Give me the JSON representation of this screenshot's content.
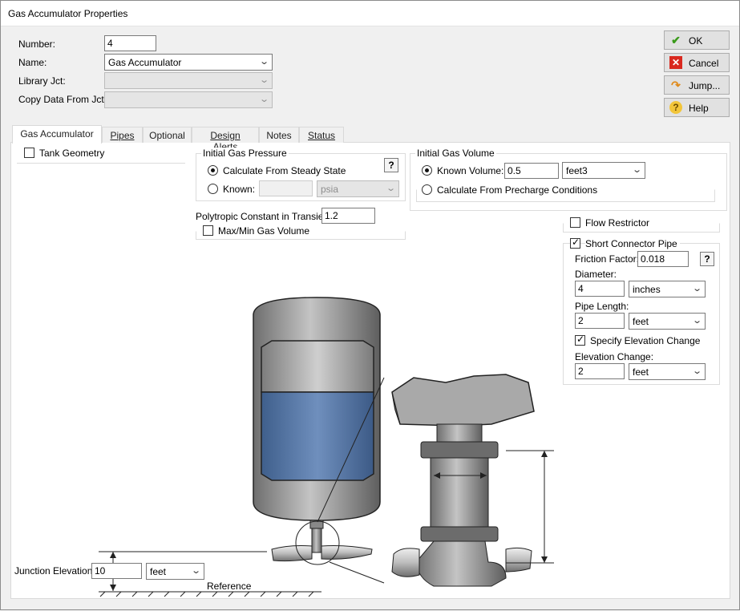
{
  "window": {
    "title": "Gas Accumulator Properties"
  },
  "header": {
    "number_label": "Number:",
    "number_value": "4",
    "name_label": "Name:",
    "name_value": "Gas Accumulator",
    "library_label": "Library Jct:",
    "library_value": "",
    "copy_label": "Copy Data From Jct...",
    "copy_value": ""
  },
  "buttons": {
    "ok": "OK",
    "cancel": "Cancel",
    "jump": "Jump...",
    "help": "Help"
  },
  "tabs": [
    {
      "label": "Gas Accumulator",
      "active": true
    },
    {
      "label": "Pipes"
    },
    {
      "label": "Optional"
    },
    {
      "label": "Design Alerts"
    },
    {
      "label": "Notes"
    },
    {
      "label": "Status"
    }
  ],
  "tank_geometry": {
    "label": "Tank Geometry",
    "checked": false
  },
  "initial_gas_pressure": {
    "title": "Initial Gas Pressure",
    "help": "?",
    "option_steady": "Calculate From Steady State",
    "option_known": "Known:",
    "known_value": "",
    "known_unit": "psia",
    "selected": "steady"
  },
  "polytropic": {
    "label": "Polytropic Constant in Transient:",
    "value": "1.2"
  },
  "max_min_volume": {
    "label": "Max/Min Gas Volume",
    "checked": false
  },
  "initial_gas_volume": {
    "title": "Initial Gas Volume",
    "option_known": "Known Volume:",
    "known_value": "0.5",
    "known_unit": "feet3",
    "option_precharge": "Calculate From Precharge Conditions",
    "selected": "known"
  },
  "flow_restrictor": {
    "label": "Flow Restrictor",
    "checked": false
  },
  "short_connector": {
    "label": "Short Connector Pipe",
    "checked": true,
    "friction_label": "Friction Factor:",
    "friction_value": "0.018",
    "help": "?",
    "diameter_label": "Diameter:",
    "diameter_value": "4",
    "diameter_unit": "inches",
    "length_label": "Pipe Length:",
    "length_value": "2",
    "length_unit": "feet",
    "elev_check_label": "Specify Elevation Change",
    "elev_checked": true,
    "elev_label": "Elevation Change:",
    "elev_value": "2",
    "elev_unit": "feet"
  },
  "junction_elevation": {
    "label": "Junction Elevation:",
    "value": "10",
    "unit": "feet"
  },
  "diagram": {
    "reference_label": "Reference"
  },
  "colors": {
    "liquid": "#4a6d9e",
    "gas": "#8f8f8f",
    "metal": "#9a9a9a"
  }
}
